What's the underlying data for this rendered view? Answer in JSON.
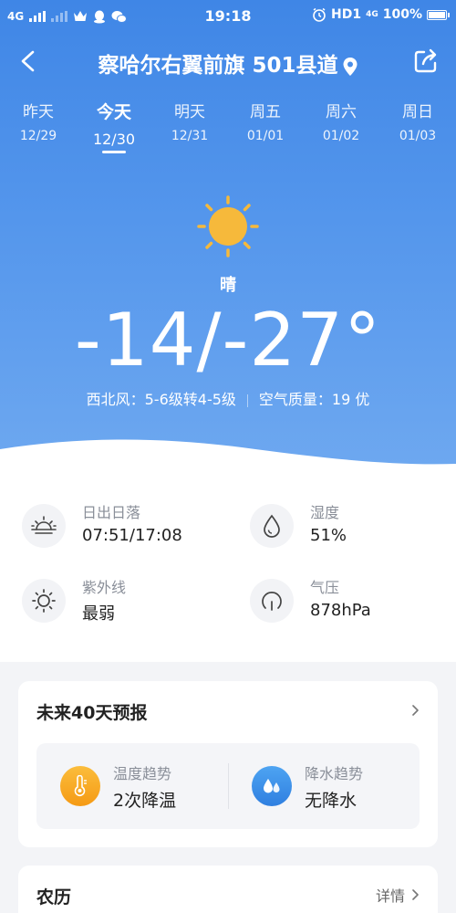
{
  "status_bar": {
    "network": "4G",
    "time": "19:18",
    "hd": "HD1",
    "lte": "4G",
    "battery": "100%"
  },
  "header": {
    "title": "察哈尔右翼前旗 501县道"
  },
  "days": [
    {
      "name": "昨天",
      "date": "12/29"
    },
    {
      "name": "今天",
      "date": "12/30"
    },
    {
      "name": "明天",
      "date": "12/31"
    },
    {
      "name": "周五",
      "date": "01/01"
    },
    {
      "name": "周六",
      "date": "01/02"
    },
    {
      "name": "周日",
      "date": "01/03"
    }
  ],
  "today": {
    "condition": "晴",
    "temperature": "-14/-27°",
    "wind": "西北风：5-6级转4-5级",
    "air_quality": "空气质量：19 优"
  },
  "details": {
    "sunrise_label": "日出日落",
    "sunrise_value": "07:51/17:08",
    "humidity_label": "湿度",
    "humidity_value": "51%",
    "uv_label": "紫外线",
    "uv_value": "最弱",
    "pressure_label": "气压",
    "pressure_value": "878hPa"
  },
  "forecast40": {
    "title": "未来40天预报",
    "temp_label": "温度趋势",
    "temp_value": "2次降温",
    "rain_label": "降水趋势",
    "rain_value": "无降水"
  },
  "lunar": {
    "title": "农历",
    "more": "详情"
  },
  "colors": {
    "hero_top": "#3f86e6",
    "hero_bottom": "#6fa9f0",
    "sun": "#f6b93b",
    "temp_icon": "#f7a31c",
    "rain_icon": "#3a8ee6"
  }
}
